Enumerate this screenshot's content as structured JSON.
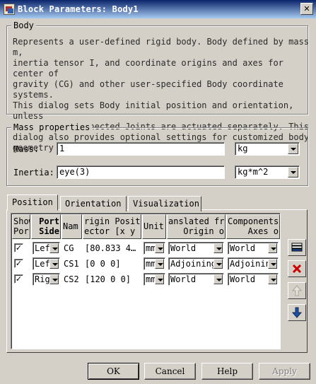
{
  "window": {
    "title": "Block Parameters: Body1",
    "close_symbol": "✕"
  },
  "body_section": {
    "legend": "Body",
    "description": "Represents a user-defined rigid body. Body defined by mass m,\ninertia tensor I, and coordinate origins and axes for center of\ngravity (CG) and other user-specified Body coordinate systems.\nThis dialog sets Body initial position and orientation, unless\nBody and/or connected Joints are actuated separately. This\ndialog also provides optional settings for customized body\ngeometry and color."
  },
  "mass_properties": {
    "legend": "Mass properties",
    "mass_label": "Mass:",
    "mass_value": "1",
    "mass_unit": "kg",
    "inertia_label": "Inertia:",
    "inertia_value": "eye(3)",
    "inertia_unit": "kg*m^2"
  },
  "tabs": [
    {
      "label": "Position",
      "active": true
    },
    {
      "label": "Orientation",
      "active": false
    },
    {
      "label": "Visualization",
      "active": false
    }
  ],
  "table": {
    "headers": {
      "show_port": [
        "Show",
        "Por"
      ],
      "port_side": [
        "Port",
        "Side"
      ],
      "name": [
        "Nam",
        ""
      ],
      "origin": [
        "rigin Positio",
        "ector [x y z"
      ],
      "unit": [
        "Unit",
        ""
      ],
      "translated": [
        "anslated fro",
        "Origin o"
      ],
      "components": [
        "Components",
        "Axes o"
      ]
    },
    "rows": [
      {
        "show": "✓",
        "side": "Lef",
        "name": "CG",
        "origin": "[80.833 4…",
        "unit": "mm",
        "translated": "World",
        "components": "World"
      },
      {
        "show": "✓",
        "side": "Lef",
        "name": "CS1",
        "origin": "[0 0 0]",
        "unit": "mm",
        "translated": "Adjoining",
        "components": "Adjoinin"
      },
      {
        "show": "✓",
        "side": "Rig",
        "name": "CS2",
        "origin": "[120 0 0]",
        "unit": "mm",
        "translated": "World",
        "components": "World"
      }
    ]
  },
  "side_buttons": {
    "add_icon": "add-row-icon",
    "delete_icon": "delete-icon",
    "up_icon": "arrow-up-icon",
    "down_icon": "arrow-down-icon",
    "delete_color": "#cc0000",
    "down_color": "#1f4fa0"
  },
  "buttons": {
    "ok": "OK",
    "cancel": "Cancel",
    "help": "Help",
    "apply": "Apply"
  }
}
